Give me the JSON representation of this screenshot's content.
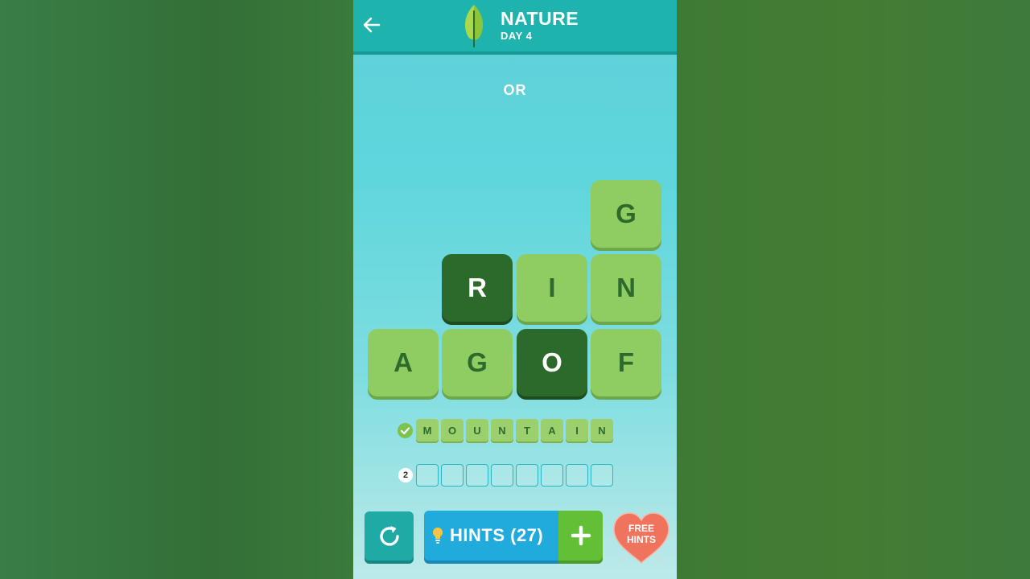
{
  "header": {
    "category": "NATURE",
    "day": "DAY 4",
    "back_icon": "back-arrow-icon",
    "category_icon": "leaf-icon"
  },
  "current_word": "OR",
  "board": {
    "rows": [
      [
        null,
        null,
        null,
        {
          "letter": "G",
          "selected": false
        }
      ],
      [
        null,
        {
          "letter": "R",
          "selected": true
        },
        {
          "letter": "I",
          "selected": false
        },
        {
          "letter": "N",
          "selected": false
        }
      ],
      [
        {
          "letter": "A",
          "selected": false
        },
        {
          "letter": "G",
          "selected": false
        },
        {
          "letter": "O",
          "selected": true
        },
        {
          "letter": "F",
          "selected": false
        }
      ]
    ]
  },
  "words": [
    {
      "status": "solved",
      "letters": [
        "M",
        "O",
        "U",
        "N",
        "T",
        "A",
        "I",
        "N"
      ],
      "icon": "check-icon"
    },
    {
      "status": "pending",
      "number": "2",
      "length": 8
    }
  ],
  "footer": {
    "refresh_icon": "refresh-icon",
    "hints_label": "HINTS (27)",
    "hints_icon": "lightbulb-icon",
    "plus_icon": "plus-icon",
    "free_hints_line1": "FREE",
    "free_hints_line2": "HINTS"
  },
  "colors": {
    "tile": "#8fcd62",
    "tile_selected": "#2b6a2b",
    "header": "#1fb3ae",
    "hints": "#21aadc",
    "plus": "#63bf36",
    "heart": "#f0735e"
  }
}
